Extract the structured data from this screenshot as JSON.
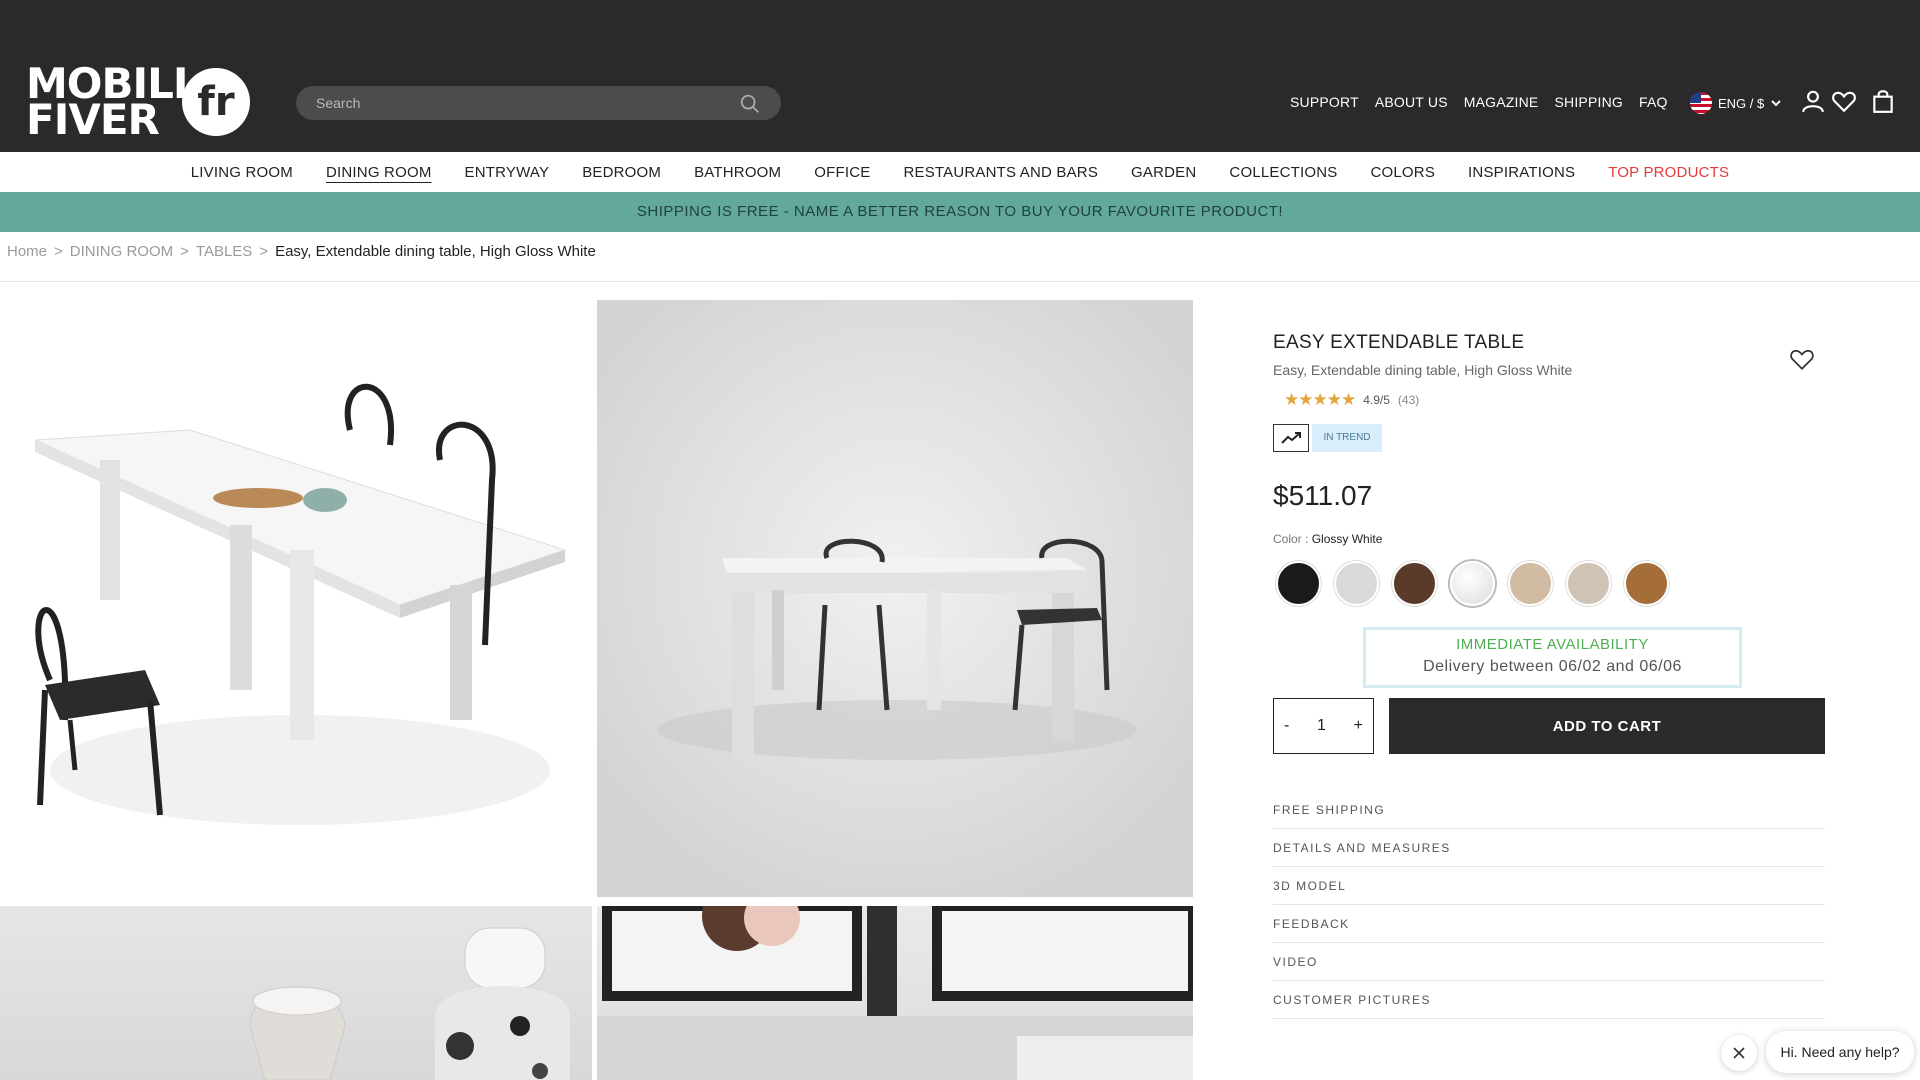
{
  "header": {
    "logo_line1": "MOBILI",
    "logo_line2": "FIVER",
    "logo_badge": "fr",
    "search_placeholder": "Search",
    "links": [
      "SUPPORT",
      "ABOUT US",
      "MAGAZINE",
      "SHIPPING",
      "FAQ"
    ],
    "language": "ENG / $",
    "icons": [
      "search-icon",
      "flag-icon",
      "chevron-down-icon",
      "user-icon",
      "heart-icon",
      "bag-icon"
    ]
  },
  "nav": {
    "items": [
      "LIVING ROOM",
      "DINING ROOM",
      "ENTRYWAY",
      "BEDROOM",
      "BATHROOM",
      "OFFICE",
      "RESTAURANTS AND BARS",
      "GARDEN",
      "COLLECTIONS",
      "COLORS",
      "INSPIRATIONS",
      "TOP PRODUCTS"
    ],
    "active": "DINING ROOM",
    "highlight": "TOP PRODUCTS"
  },
  "promo": "SHIPPING IS FREE - NAME A BETTER REASON TO BUY YOUR FAVOURITE PRODUCT!",
  "breadcrumb": {
    "home": "Home",
    "category": "DINING ROOM",
    "subcategory": "TABLES",
    "current": "Easy, Extendable dining table, High Gloss White",
    "separator": ">"
  },
  "product": {
    "title": "EASY EXTENDABLE TABLE",
    "subtitle": "Easy, Extendable dining table, High Gloss White",
    "stars": "★★★★★",
    "rating": "4.9/5",
    "reviews": "(43)",
    "badge": "IN TREND",
    "price": "$511.07",
    "color_label": "Color : ",
    "color_value": "Glossy White",
    "swatches": [
      "#1a1a1a",
      "#d9d9d9",
      "#5a3a29",
      "#ededed",
      "#d2bba3",
      "#cfc3b6",
      "#a56d38"
    ],
    "selected_swatch": 3,
    "availability_title": "IMMEDIATE AVAILABILITY",
    "availability_delivery": "Delivery between 06/02 and 06/06",
    "qty_minus": "-",
    "qty_value": "1",
    "qty_plus": "+",
    "add_to_cart": "ADD TO CART",
    "accordions": [
      "FREE SHIPPING",
      "DETAILS AND MEASURES",
      "3D MODEL",
      "FEEDBACK",
      "VIDEO",
      "CUSTOMER PICTURES"
    ]
  },
  "chat": {
    "message": "Hi. Need any help?",
    "close": "×"
  },
  "colors": {
    "header_bg": "#2b292a",
    "promo_bg": "#62a99b",
    "accent_red": "#e23b3b",
    "star": "#e4a43c",
    "availability_green": "#4caf50"
  }
}
